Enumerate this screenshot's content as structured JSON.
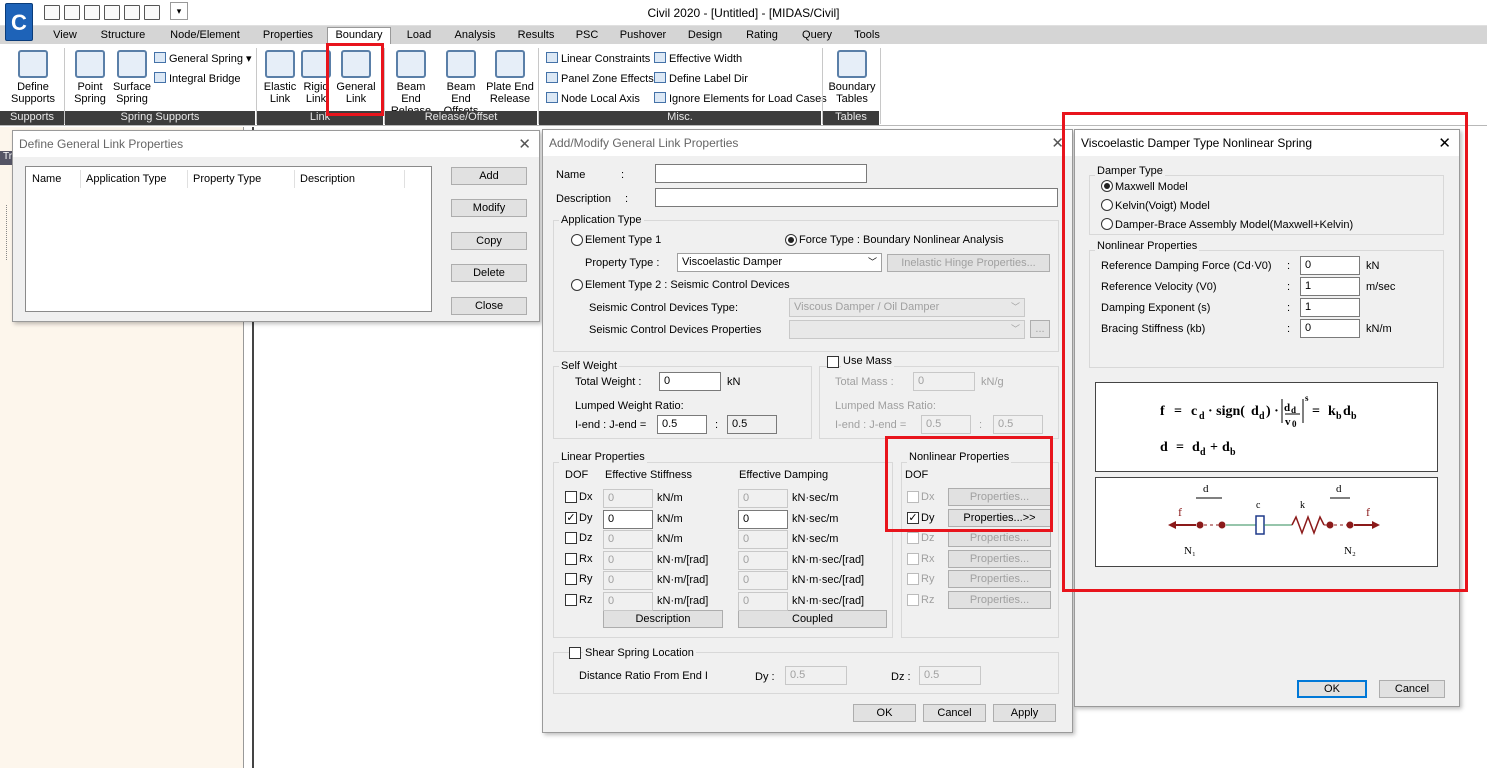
{
  "app": {
    "title": "Civil 2020 - [Untitled] - [MIDAS/Civil]",
    "logo": "C"
  },
  "tabs": [
    "View",
    "Structure",
    "Node/Element",
    "Properties",
    "Boundary",
    "Load",
    "Analysis",
    "Results",
    "PSC",
    "Pushover",
    "Design",
    "Rating",
    "Query",
    "Tools"
  ],
  "ribbon": {
    "define_supports": "Define\nSupports",
    "point_spring": "Point\nSpring",
    "surface_spring": "Surface\nSpring",
    "general_spring": "General Spring",
    "integral_bridge": "Integral Bridge",
    "elastic_link": "Elastic\nLink",
    "rigid_link": "Rigid\nLink",
    "general_link": "General\nLink",
    "beam_end_release": "Beam End\nRelease",
    "beam_end_offsets": "Beam End\nOffsets",
    "plate_end_release": "Plate End\nRelease",
    "linear_constraints": "Linear Constraints",
    "panel_zone_effects": "Panel Zone Effects",
    "node_local_axis": "Node Local Axis",
    "effective_width": "Effective Width",
    "define_label_dir": "Define Label Dir",
    "ignore_elements": "Ignore Elements for Load Cases",
    "boundary_tables": "Boundary\nTables",
    "groups": [
      "Supports",
      "Spring Supports",
      "Link",
      "Release/Offset",
      "Misc.",
      "Tables"
    ]
  },
  "left_panel": {
    "tab": "Tr"
  },
  "define_dialog": {
    "title": "Define General Link Properties",
    "columns": [
      "Name",
      "Application Type",
      "Property Type",
      "Description"
    ],
    "buttons": [
      "Add",
      "Modify",
      "Copy",
      "Delete",
      "Close"
    ]
  },
  "modify_dialog": {
    "title": "Add/Modify General Link Properties",
    "name_label": "Name",
    "desc_label": "Description",
    "colon": ":",
    "app_type": "Application Type",
    "elem_type1": "Element Type 1",
    "force_type": "Force Type : Boundary Nonlinear Analysis",
    "property_type_label": "Property Type :",
    "property_type_value": "Viscoelastic Damper",
    "inelastic_btn": "Inelastic Hinge Properties...",
    "elem_type2": "Element Type 2 : Seismic Control Devices",
    "scd_type_label": "Seismic Control Devices Type",
    "scd_type_value": "Viscous Damper / Oil Damper",
    "scd_props_label": "Seismic Control Devices Properties",
    "ellipsis": "...",
    "self_weight": "Self Weight",
    "total_weight": "Total Weight :",
    "total_weight_val": "0",
    "kn": "kN",
    "lumped_weight": "Lumped Weight Ratio:",
    "ij_end": "I-end : J-end =",
    "ratio_i": "0.5",
    "ratio_j": "0.5",
    "use_mass": "Use Mass",
    "total_mass": "Total Mass :",
    "total_mass_val": "0",
    "kn_g": "kN/g",
    "lumped_mass": "Lumped Mass Ratio:",
    "linear_props": "Linear Properties",
    "dof": "DOF",
    "eff_stiff": "Effective Stiffness",
    "eff_damp": "Effective Damping",
    "nonlinear_props": "Nonlinear Properties",
    "properties_btn": "Properties...",
    "properties_btn_on": "Properties...>>",
    "dof_rows": [
      {
        "name": "Dx",
        "checked": false,
        "stiff": "0",
        "sunit": "kN/m",
        "damp": "0",
        "dunit": "kN·sec/m"
      },
      {
        "name": "Dy",
        "checked": true,
        "stiff": "0",
        "sunit": "kN/m",
        "damp": "0",
        "dunit": "kN·sec/m"
      },
      {
        "name": "Dz",
        "checked": false,
        "stiff": "0",
        "sunit": "kN/m",
        "damp": "0",
        "dunit": "kN·sec/m"
      },
      {
        "name": "Rx",
        "checked": false,
        "stiff": "0",
        "sunit": "kN·m/[rad]",
        "damp": "0",
        "dunit": "kN·m·sec/[rad]"
      },
      {
        "name": "Ry",
        "checked": false,
        "stiff": "0",
        "sunit": "kN·m/[rad]",
        "damp": "0",
        "dunit": "kN·m·sec/[rad]"
      },
      {
        "name": "Rz",
        "checked": false,
        "stiff": "0",
        "sunit": "kN·m/[rad]",
        "damp": "0",
        "dunit": "kN·m·sec/[rad]"
      }
    ],
    "description_btn": "Description",
    "coupled_btn": "Coupled",
    "shear_spring": "Shear Spring Location",
    "dist_ratio": "Distance Ratio From End I",
    "dy_label": "Dy :",
    "dy_val": "0.5",
    "dz_label": "Dz :",
    "dz_val": "0.5",
    "ok": "OK",
    "cancel": "Cancel",
    "apply": "Apply"
  },
  "damper_dialog": {
    "title": "Viscoelastic Damper Type Nonlinear Spring",
    "damper_type": "Damper Type",
    "models": [
      "Maxwell Model",
      "Kelvin(Voigt) Model",
      "Damper-Brace Assembly Model(Maxwell+Kelvin)"
    ],
    "selected_model": 0,
    "nonlinear_props": "Nonlinear Properties",
    "params": [
      {
        "label": "Reference Damping Force (Cd·V0)",
        "value": "0",
        "unit": "kN"
      },
      {
        "label": "Reference Velocity (V0)",
        "value": "1",
        "unit": "m/sec"
      },
      {
        "label": "Damping Exponent (s)",
        "value": "1",
        "unit": ""
      },
      {
        "label": "Bracing Stiffness (kb)",
        "value": "0",
        "unit": "kN/m"
      }
    ],
    "colon": ":",
    "ok": "OK",
    "cancel": "Cancel"
  },
  "colors": {
    "highlight": "#e8141c",
    "accent": "#0078d7",
    "panel_bg": "#fdf6ec"
  }
}
